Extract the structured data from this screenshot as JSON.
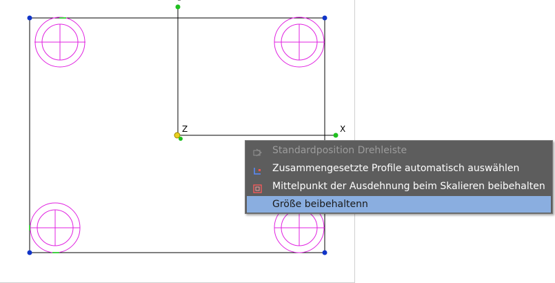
{
  "canvas": {
    "axis_labels": {
      "x": "X",
      "z": "Z"
    },
    "colors": {
      "outline": "#000000",
      "circles": "#e020e0",
      "corner_handle": "#1034c8",
      "axis_handle": "#20c020",
      "origin_handle": "#e8d020"
    }
  },
  "context_menu": {
    "items": [
      {
        "label": "Standardposition Drehleiste",
        "icon": "rotate-bar-icon",
        "enabled": false,
        "highlighted": false
      },
      {
        "label": "Zusammengesetzte Profile automatisch auswählen",
        "icon": "profile-select-icon",
        "enabled": true,
        "highlighted": false
      },
      {
        "label": "Mittelpunkt der Ausdehnung beim Skalieren beibehalten",
        "icon": "scale-center-icon",
        "enabled": true,
        "highlighted": false
      },
      {
        "label": "Größe beibehaltenn",
        "icon": "",
        "enabled": true,
        "highlighted": true
      }
    ],
    "colors": {
      "background": "#5d5d5d",
      "highlight": "#8aaee0"
    }
  }
}
